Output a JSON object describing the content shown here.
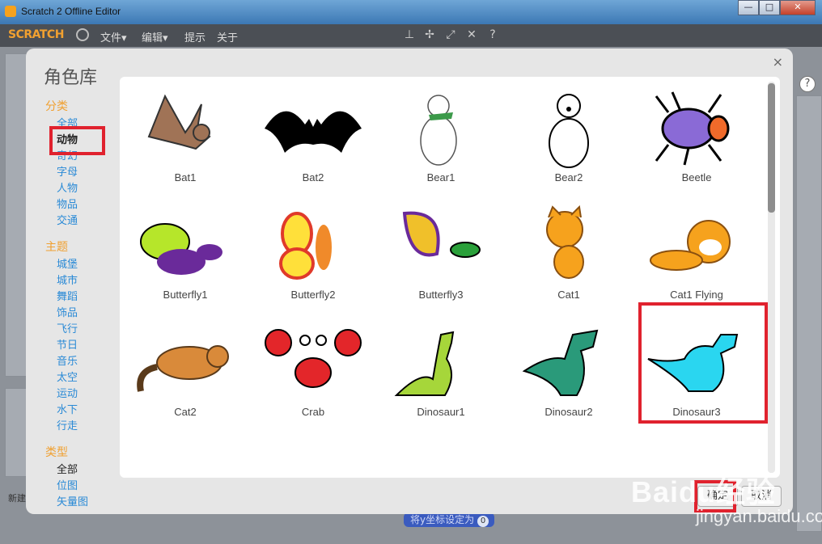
{
  "window": {
    "title": "Scratch 2 Offline Editor",
    "buttons": [
      "—",
      "□",
      "✕"
    ]
  },
  "menubar": {
    "logo": "SCRATCH",
    "items": [
      "文件▾",
      "编辑▾",
      "提示",
      "关于"
    ]
  },
  "background": {
    "block_label": "将y坐标设定为",
    "block_value": "0",
    "new_label": "新建"
  },
  "dialog": {
    "title": "角色库",
    "close": "×",
    "sections": [
      {
        "heading": "分类",
        "items": [
          "全部",
          "动物",
          "奇幻",
          "字母",
          "人物",
          "物品",
          "交通"
        ],
        "selected": "动物"
      },
      {
        "heading": "主题",
        "items": [
          "城堡",
          "城市",
          "舞蹈",
          "饰品",
          "飞行",
          "节日",
          "音乐",
          "太空",
          "运动",
          "水下",
          "行走"
        ]
      },
      {
        "heading": "类型",
        "items": [
          "全部",
          "位图",
          "矢量图"
        ],
        "selected": "全部"
      }
    ],
    "sprites": [
      "Bat1",
      "Bat2",
      "Bear1",
      "Bear2",
      "Beetle",
      "Butterfly1",
      "Butterfly2",
      "Butterfly3",
      "Cat1",
      "Cat1 Flying",
      "Cat2",
      "Crab",
      "Dinosaur1",
      "Dinosaur2",
      "Dinosaur3",
      "",
      "",
      "",
      "",
      ""
    ],
    "ok_label": "确定",
    "cancel_label": "取消"
  },
  "watermark": {
    "brand": "Baidu经验",
    "url": "jingyan.baidu.com"
  },
  "colors": {
    "highlight": "#e0222e",
    "category_heading": "#f0a030",
    "category_link": "#2a8ad6"
  }
}
